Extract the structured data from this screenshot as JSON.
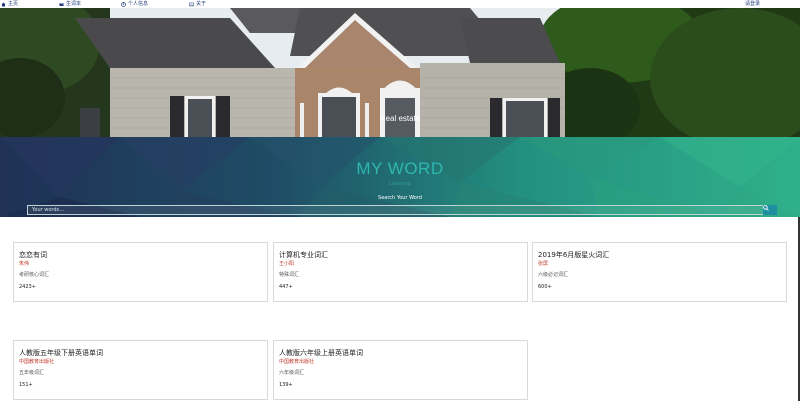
{
  "nav": {
    "home": "主页",
    "vocab": "生词本",
    "profile": "个人信息",
    "about": "关于",
    "login": "请登录"
  },
  "hero": {
    "title": "Real estate"
  },
  "banner": {
    "title": "MY WORD",
    "subtitle": "Learning",
    "search_label": "Search Your Word",
    "search_placeholder": "Your words..."
  },
  "cards": [
    {
      "title": "恋恋有词",
      "author": "朱伟",
      "desc": "考研核心词汇",
      "count": "2423+"
    },
    {
      "title": "计算机专业词汇",
      "author": "王小阳",
      "desc": "特殊词汇",
      "count": "447+"
    },
    {
      "title": "2019年6月版星火词汇",
      "author": "张屏",
      "desc": "六级必记词汇",
      "count": "600+"
    },
    {
      "title": "人教版五年级下册英语单词",
      "author": "中国教育出版社",
      "desc": "五年级词汇",
      "count": "151+"
    },
    {
      "title": "人教版六年级上册英语单词",
      "author": "中国教育出版社",
      "desc": "六年级词汇",
      "count": "139+"
    }
  ],
  "colors": {
    "accent": "#2fb7b0",
    "author": "#c0392b",
    "search_button": "#1d8fa0"
  }
}
